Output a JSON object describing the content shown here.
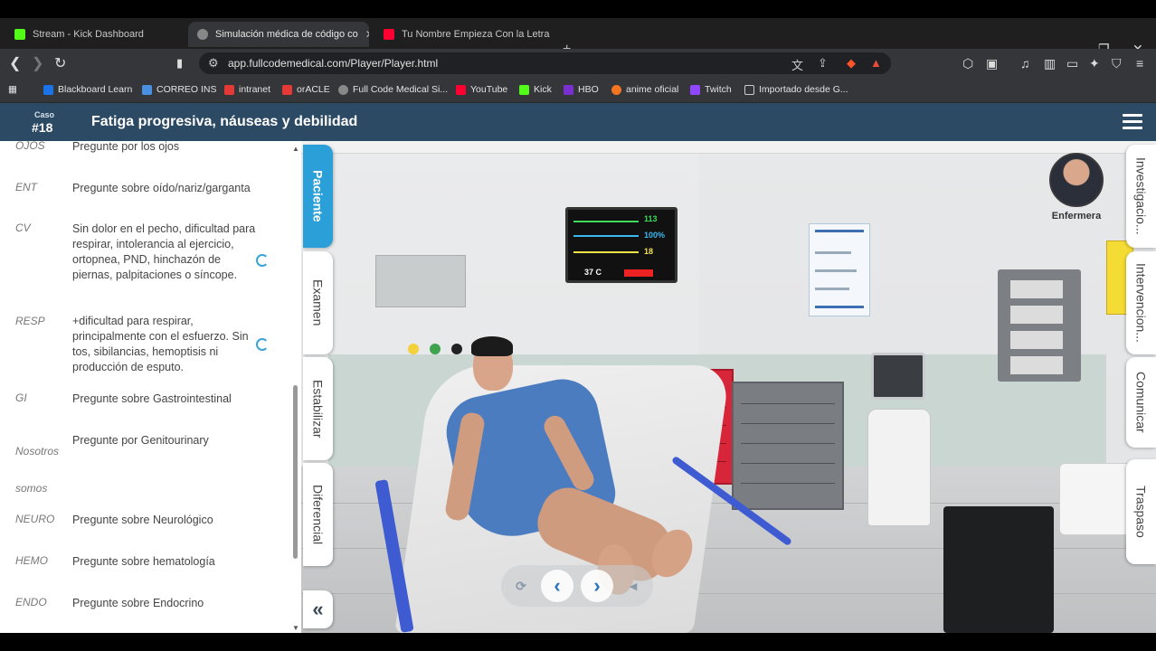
{
  "browser": {
    "tabs": [
      {
        "title": "Stream - Kick Dashboard",
        "favicon": "kick-icon",
        "active": false
      },
      {
        "title": "Simulación médica de código co",
        "favicon": "globe-icon",
        "active": true
      },
      {
        "title": "Tu Nombre Empieza Con la Letra",
        "favicon": "youtube-icon",
        "active": false
      }
    ],
    "url": "app.fullcodemedical.com/Player/Player.html",
    "bookmarks": [
      {
        "label": "Blackboard Learn",
        "color": "#1a73e8"
      },
      {
        "label": "CORREO INS",
        "color": "#4a90e2"
      },
      {
        "label": "intranet",
        "color": "#e53935"
      },
      {
        "label": "orACLE",
        "color": "#e53935"
      },
      {
        "label": "Full Code Medical Si...",
        "color": "#888888"
      },
      {
        "label": "YouTube",
        "color": "#ff0033"
      },
      {
        "label": "Kick",
        "color": "#53fc18"
      },
      {
        "label": "HBO",
        "color": "#7a2fd1"
      },
      {
        "label": "anime oficial",
        "color": "#f47521"
      },
      {
        "label": "Twitch",
        "color": "#9146ff"
      },
      {
        "label": "Importado desde G...",
        "color": "#cccccc"
      }
    ]
  },
  "app": {
    "case_label": "Caso",
    "case_number": "#18",
    "title": "Fatiga progresiva, náuseas y debilidad",
    "header_color": "#2c4a63"
  },
  "review_of_systems": [
    {
      "key": "OJOS",
      "value": "Pregunte por los ojos",
      "refresh": false
    },
    {
      "key": "ENT",
      "value": "Pregunte sobre oído/nariz/garganta",
      "refresh": false
    },
    {
      "key": "CV",
      "value": "Sin dolor en el pecho, dificultad para respirar, intolerancia al ejercicio, ortopnea, PND, hinchazón de piernas, palpitaciones o síncope.",
      "refresh": true
    },
    {
      "key": "RESP",
      "value": "+dificultad para respirar, principalmente con el esfuerzo. Sin tos, sibilancias, hemoptisis ni producción de esputo.",
      "refresh": true
    },
    {
      "key": "GI",
      "value": "Pregunte sobre Gastrointestinal",
      "refresh": false
    },
    {
      "key": "Nosotros somos",
      "value": "Pregunte por Genitourinary",
      "refresh": false
    },
    {
      "key": "NEURO",
      "value": "Pregunte sobre Neurológico",
      "refresh": false
    },
    {
      "key": "HEMO",
      "value": "Pregunte sobre hematología",
      "refresh": false
    },
    {
      "key": "ENDO",
      "value": "Pregunte sobre Endocrino",
      "refresh": false
    }
  ],
  "left_tabs": [
    {
      "label": "Paciente",
      "active": true
    },
    {
      "label": "Examen",
      "active": false
    },
    {
      "label": "Estabilizar",
      "active": false
    },
    {
      "label": "Diferencial",
      "active": false
    }
  ],
  "right_tabs": [
    "Investigacio...",
    "Intervencion...",
    "Comunicar",
    "Traspaso"
  ],
  "monitor": {
    "hr": "113",
    "spo2": "100%",
    "rr": "18",
    "temp": "37 C"
  },
  "nurse": {
    "label": "Enfermera"
  },
  "accent_color": "#2b9fd8"
}
